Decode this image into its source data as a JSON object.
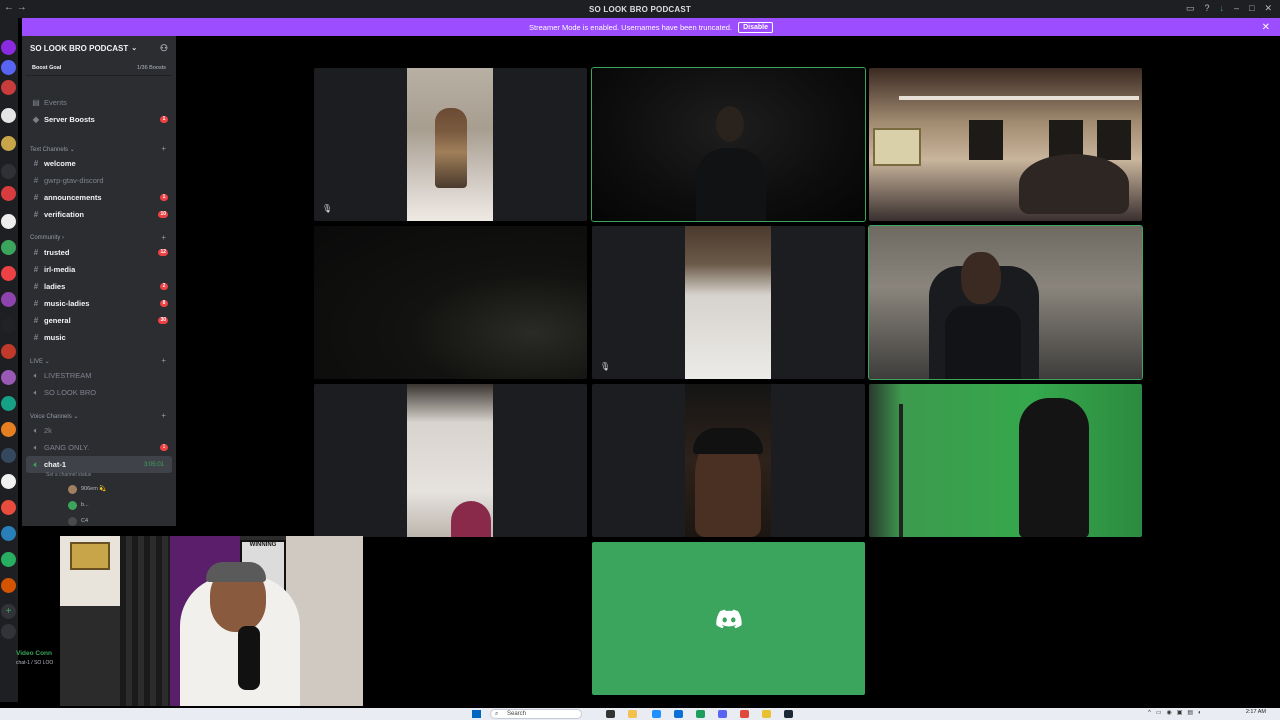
{
  "window": {
    "title": "SO LOOK BRO PODCAST",
    "nav_arrows": "← →"
  },
  "banner": {
    "text": "Streamer Mode is enabled. Usernames have been truncated.",
    "button": "Disable",
    "close": "✕"
  },
  "server": {
    "name": "SO LOOK BRO PODCAST",
    "boost_goal": "Boost Goal",
    "boost_count": "1/36 Boosts"
  },
  "channels": {
    "events": "Events",
    "server_boosts": "Server Boosts",
    "server_boosts_badge": "1",
    "cat_text": "Text Channels",
    "welcome": "welcome",
    "gwrp": "gwrp-gtav-discord",
    "announcements": "announcements",
    "announcements_badge": "1",
    "verification": "verification",
    "verification_badge": "10",
    "cat_community": "Community",
    "trusted": "trusted",
    "trusted_badge": "12",
    "irl_media": "irl-media",
    "ladies": "ladies",
    "ladies_badge": "2",
    "music_ladies": "music-ladies",
    "music_ladies_badge": "8",
    "general": "general",
    "general_badge": "30",
    "music": "music",
    "cat_live": "LIVE",
    "livestream": "LIVESTREAM",
    "so_look_bro": "SO LOOK BRO",
    "cat_voice": "Voice Channels",
    "twok": "2k",
    "gang_only": "GANG ONLY.",
    "gang_only_badge": "1",
    "chat1": "chat-1",
    "chat1_timer": "3:05:01",
    "chat1_status": "Set a channel status",
    "member1": "906em 💫",
    "member2": "b...",
    "member3": "C4"
  },
  "voice_connected": {
    "label": "Video Conn",
    "sub": "chat-1 / SO LOO"
  },
  "cam": {
    "poster_text": "WINNING"
  },
  "taskbar": {
    "search_placeholder": "Search",
    "clock": "2:17 AM"
  },
  "colors": {
    "accent_green": "#3ba55d",
    "banner_purple": "#9b4dff",
    "badge_red": "#ed4245",
    "sidebar_bg": "#2b2d31"
  }
}
